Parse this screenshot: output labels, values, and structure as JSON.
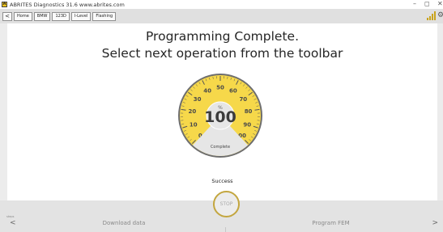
{
  "window": {
    "app_icon_letter": "A",
    "title": "ABRITES Diagnostics 31.6   www.abrites.com",
    "controls": {
      "minimize": "–",
      "maximize": "◻",
      "close": "✕"
    }
  },
  "breadcrumbs": [
    {
      "label": "<"
    },
    {
      "label": "Home"
    },
    {
      "label": "BMW"
    },
    {
      "label": "123D"
    },
    {
      "label": "I-Level"
    },
    {
      "label": "Flashing"
    }
  ],
  "message": {
    "line1": "Programming Complete.",
    "line2": "Select next operation from the toolbar"
  },
  "gauge": {
    "value": 100,
    "unit": "%",
    "display": "100",
    "status": "Complete",
    "ticks": [
      "0",
      "10",
      "20",
      "30",
      "40",
      "50",
      "60",
      "70",
      "80",
      "90",
      "100"
    ],
    "colors": {
      "accent": "#f6d84a",
      "dark": "#6e6e6e",
      "inner": "#e6e6e6"
    }
  },
  "status_text": "Success",
  "stop_button": "STOP",
  "bottom": {
    "step_label": "steps",
    "prev": "<",
    "next": ">",
    "download_label": "Download data",
    "program_label": "Program FEM"
  }
}
